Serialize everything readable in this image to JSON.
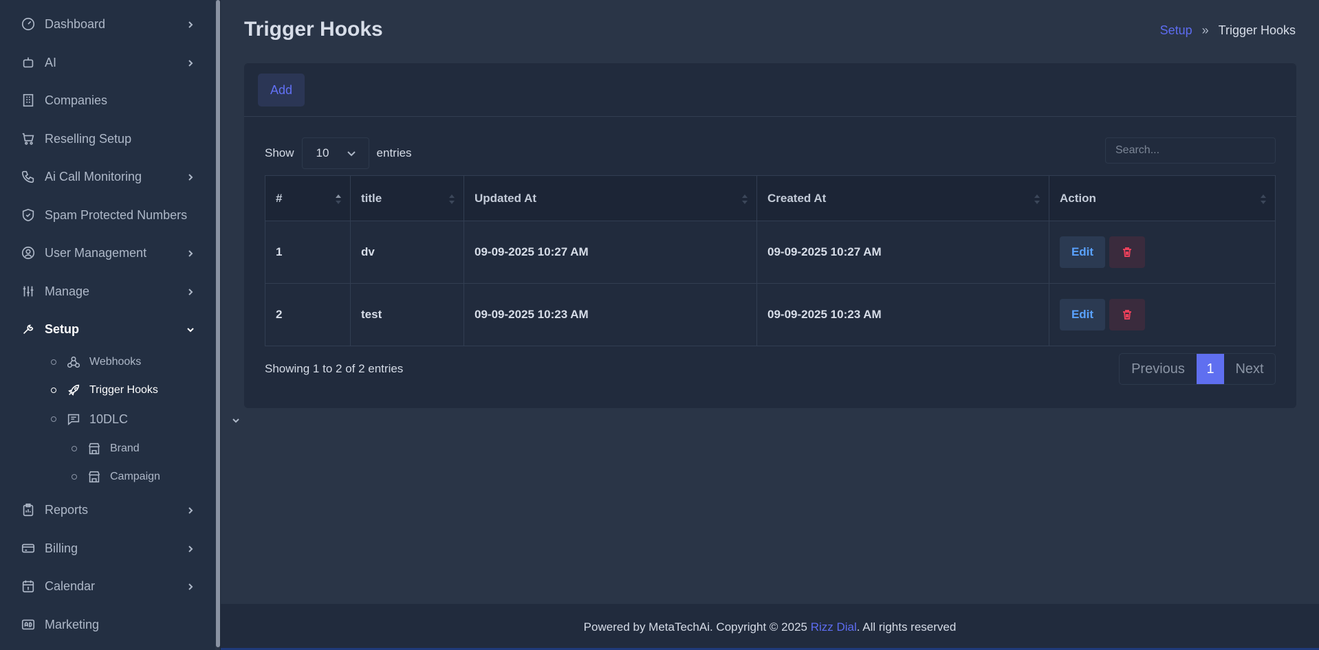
{
  "sidebar": {
    "items": [
      {
        "label": "Dashboard",
        "icon": "gauge-icon",
        "chevron": true
      },
      {
        "label": "AI",
        "icon": "robot-icon",
        "chevron": true
      },
      {
        "label": "Companies",
        "icon": "building-icon",
        "chevron": false
      },
      {
        "label": "Reselling Setup",
        "icon": "cart-icon",
        "chevron": false
      },
      {
        "label": "Ai Call Monitoring",
        "icon": "phone-icon",
        "chevron": true
      },
      {
        "label": "Spam Protected Numbers",
        "icon": "shield-icon",
        "chevron": false
      },
      {
        "label": "User Management",
        "icon": "user-circle-icon",
        "chevron": true
      },
      {
        "label": "Manage",
        "icon": "sliders-icon",
        "chevron": true
      },
      {
        "label": "Setup",
        "icon": "tools-icon",
        "chevron": true,
        "expanded": true,
        "active": true
      },
      {
        "label": "Reports",
        "icon": "clipboard-icon",
        "chevron": true
      },
      {
        "label": "Billing",
        "icon": "card-icon",
        "chevron": true
      },
      {
        "label": "Calendar",
        "icon": "calendar-icon",
        "chevron": true
      },
      {
        "label": "Marketing",
        "icon": "ad-icon",
        "chevron": false
      }
    ],
    "setup_children": [
      {
        "label": "Webhooks",
        "icon": "webhook-icon"
      },
      {
        "label": "Trigger Hooks",
        "icon": "rocket-icon",
        "active": true
      },
      {
        "label": "10DLC",
        "icon": "message-icon",
        "expanded": true
      }
    ],
    "dlc_children": [
      {
        "label": "Brand",
        "icon": "store-icon"
      },
      {
        "label": "Campaign",
        "icon": "store-icon"
      }
    ]
  },
  "page": {
    "title": "Trigger Hooks",
    "breadcrumb": {
      "parent": "Setup",
      "current": "Trigger Hooks"
    }
  },
  "toolbar": {
    "add_label": "Add"
  },
  "table_controls": {
    "show_label": "Show",
    "page_length": "10",
    "entries_label": "entries",
    "search_placeholder": "Search..."
  },
  "table": {
    "columns": [
      "#",
      "title",
      "Updated At",
      "Created At",
      "Action"
    ],
    "rows": [
      {
        "num": "1",
        "title": "dv",
        "updated": "09-09-2025 10:27 AM",
        "created": "09-09-2025 10:27 AM",
        "edit": "Edit"
      },
      {
        "num": "2",
        "title": "test",
        "updated": "09-09-2025 10:23 AM",
        "created": "09-09-2025 10:23 AM",
        "edit": "Edit"
      }
    ]
  },
  "pagination": {
    "info": "Showing 1 to 2 of 2 entries",
    "previous": "Previous",
    "current": "1",
    "next": "Next"
  },
  "footer": {
    "prefix": "Powered by MetaTechAi. Copyright © 2025 ",
    "brand": "Rizz Dial",
    "suffix": ". All rights reserved"
  },
  "colors": {
    "background": "#2a3547",
    "sidebar": "#232f42",
    "card": "#212b3d",
    "accent": "#5f6ff0",
    "edit": "#5aa2ff",
    "delete": "#e8405a"
  }
}
